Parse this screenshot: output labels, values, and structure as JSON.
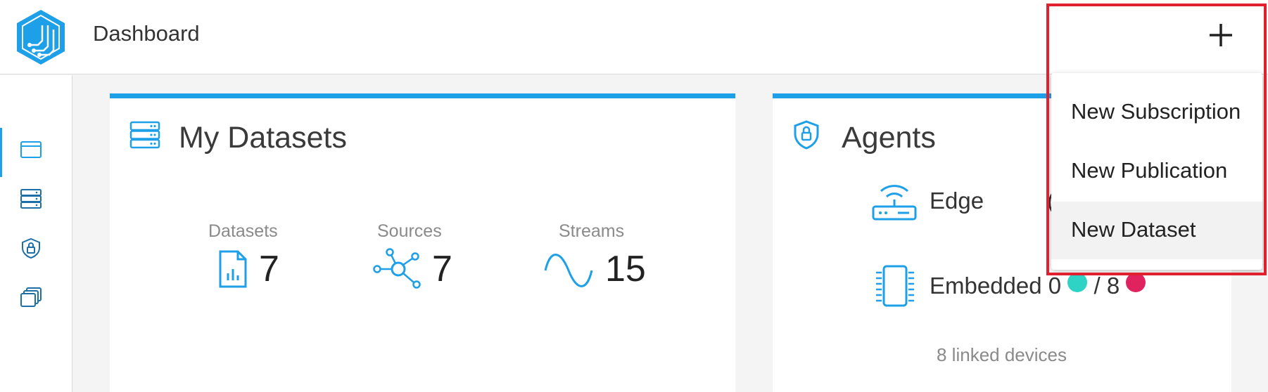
{
  "header": {
    "title": "Dashboard",
    "add_icon": "plus-icon"
  },
  "sidebar": {
    "items": [
      {
        "name": "dashboard",
        "icon": "window-icon",
        "active": true
      },
      {
        "name": "datasets",
        "icon": "server-icon",
        "active": false
      },
      {
        "name": "agents",
        "icon": "shield-lock-icon",
        "active": false
      },
      {
        "name": "copies",
        "icon": "stack-icon",
        "active": false
      }
    ]
  },
  "datasets_card": {
    "title": "My Datasets",
    "icon": "server-icon",
    "stats": [
      {
        "label": "Datasets",
        "value": "7",
        "icon": "file-chart-icon"
      },
      {
        "label": "Sources",
        "value": "7",
        "icon": "hub-icon"
      },
      {
        "label": "Streams",
        "value": "15",
        "icon": "sine-wave-icon"
      }
    ]
  },
  "agents_card": {
    "title": "Agents",
    "icon": "shield-lock-icon",
    "edge_label": "Edge",
    "edge_partial": "(",
    "embedded_label": "Embedded",
    "embedded_online": "0",
    "embedded_separator": "/",
    "embedded_total": "8",
    "online_color": "#2ed3c6",
    "offline_color": "#e0235e",
    "linked_devices": "8 linked devices"
  },
  "dropdown": {
    "items": [
      {
        "label": "New Subscription"
      },
      {
        "label": "New Publication"
      },
      {
        "label": "New Dataset",
        "hovered": true
      }
    ]
  },
  "colors": {
    "accent": "#1ea0e8",
    "highlight": "#e0202e"
  }
}
